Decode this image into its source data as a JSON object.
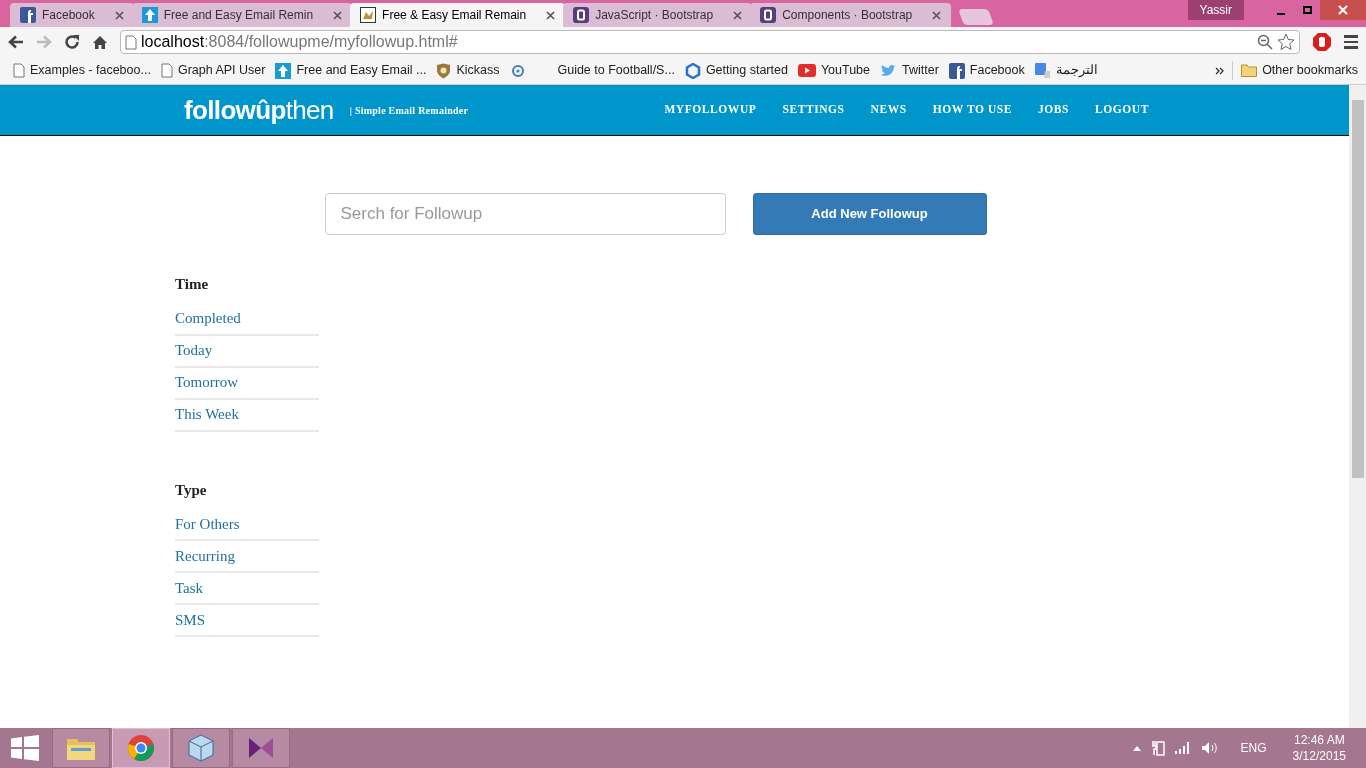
{
  "browser": {
    "tabs": [
      {
        "title": "Facebook",
        "selected": false
      },
      {
        "title": "Free and Easy Email Remin",
        "selected": false
      },
      {
        "title": "Free & Easy Email Remain",
        "selected": true
      },
      {
        "title": "JavaScript · Bootstrap",
        "selected": false
      },
      {
        "title": "Components · Bootstrap",
        "selected": false
      }
    ],
    "profile": "Yassir",
    "address": {
      "host": "localhost",
      "rest": ":8084/followupme/myfollowup.html#"
    },
    "bookmarks": [
      "Examples - faceboo...",
      "Graph API User",
      "Free and Easy Email ...",
      "Kickass",
      "Guide to Football/S...",
      "Getting started",
      "YouTube",
      "Twitter",
      "Facebook",
      "الترجمة"
    ],
    "other_bookmarks": "Other bookmarks"
  },
  "site": {
    "logo": "**followûp**then",
    "tagline": "| Simple Email Remainder",
    "nav": [
      "MYFOLLOWUP",
      "SETTINGS",
      "NEWS",
      "HOW TO USE",
      "JOBS",
      "LOGOUT"
    ],
    "search": {
      "placeholder": "Serch for Followup"
    },
    "add_button": "Add New Followup",
    "filters": [
      {
        "heading": "Time",
        "items": [
          "Completed",
          "Today",
          "Tomorrow",
          "This Week"
        ]
      },
      {
        "heading": "Type",
        "items": [
          "For Others",
          "Recurring",
          "Task",
          "SMS"
        ]
      }
    ]
  },
  "taskbar": {
    "apps": [
      {
        "kind": "explorer",
        "selected": false
      },
      {
        "kind": "chrome",
        "selected": true
      },
      {
        "kind": "box",
        "selected": false
      },
      {
        "kind": "visualstudio",
        "selected": false
      }
    ],
    "language": "ENG",
    "time": "12:46 AM",
    "date": "3/12/2015"
  }
}
